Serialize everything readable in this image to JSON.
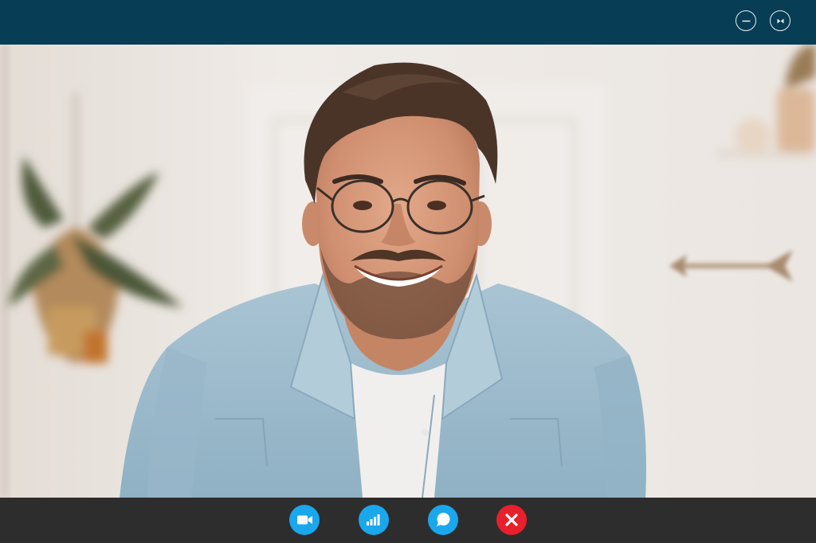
{
  "window": {
    "controls": [
      {
        "id": "minimize",
        "icon": "minimize-icon"
      },
      {
        "id": "restore",
        "icon": "restore-icon"
      }
    ]
  },
  "video": {
    "content": "remote-participant-video"
  },
  "call_controls": [
    {
      "id": "camera",
      "icon": "video-camera-icon"
    },
    {
      "id": "signal",
      "icon": "signal-strength-icon"
    },
    {
      "id": "chat",
      "icon": "chat-bubble-icon"
    },
    {
      "id": "hangup",
      "icon": "close-icon"
    }
  ],
  "colors": {
    "titlebar": "#073d55",
    "controlbar": "#2d2d2d",
    "control_button": "#1aa7ec",
    "hangup_button": "#e8202c",
    "window_control_outline": "#e8eef2"
  }
}
